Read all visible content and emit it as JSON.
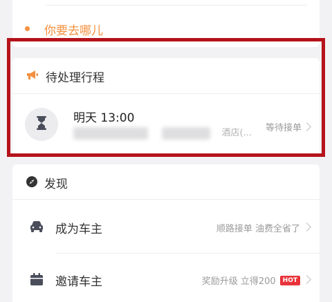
{
  "destination": {
    "placeholder_text": "你要去哪儿"
  },
  "pending": {
    "title": "待处理行程",
    "trip": {
      "time": "明天 13:00",
      "route_suffix": "酒店(...",
      "status": "等待接单"
    }
  },
  "discover": {
    "title": "发现",
    "items": [
      {
        "label": "成为车主",
        "subtitle": "顺路接单 油费全省了",
        "icon": "car-icon"
      },
      {
        "label": "邀请车主",
        "subtitle": "奖励升级 立得200",
        "badge": "HOT",
        "icon": "calendar-icon"
      }
    ]
  },
  "colors": {
    "accent_orange": "#f4903f",
    "highlight_red": "#b5121b",
    "hot_badge": "#e8333a",
    "icon_dark": "#4a4d5a"
  }
}
